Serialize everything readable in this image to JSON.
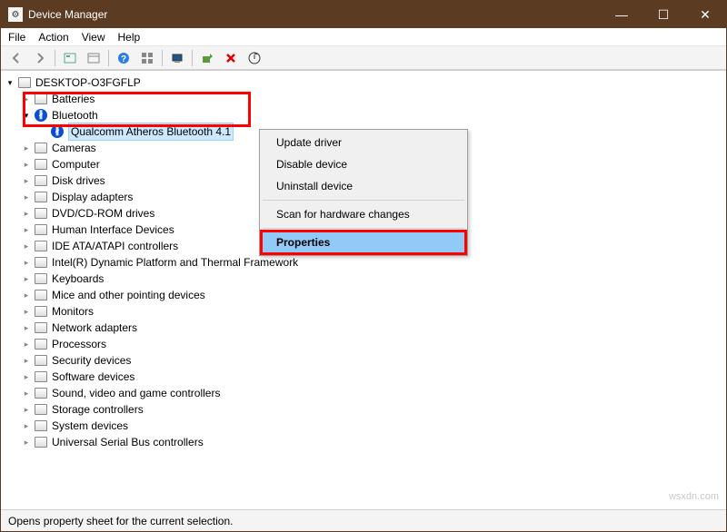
{
  "window": {
    "title": "Device Manager",
    "min_tooltip": "Minimize",
    "max_tooltip": "Maximize",
    "close_tooltip": "Close"
  },
  "menu": {
    "file": "File",
    "action": "Action",
    "view": "View",
    "help": "Help"
  },
  "toolbar_icons": [
    "back-icon",
    "forward-icon",
    "sep",
    "show-folder-icon",
    "properties-icon",
    "sep",
    "help-icon",
    "tile-icon",
    "sep",
    "monitor-icon",
    "sep",
    "scan-hw-icon",
    "remove-icon",
    "update-icon"
  ],
  "tree": {
    "root": "DESKTOP-O3FGFLP",
    "items": [
      {
        "label": "Batteries",
        "icon": "battery"
      },
      {
        "label": "Bluetooth",
        "icon": "bluetooth",
        "expanded": true,
        "children": [
          {
            "label": "Qualcomm Atheros Bluetooth 4.1",
            "icon": "bluetooth",
            "selected": true
          }
        ]
      },
      {
        "label": "Cameras",
        "icon": "camera"
      },
      {
        "label": "Computer",
        "icon": "computer"
      },
      {
        "label": "Disk drives",
        "icon": "disk"
      },
      {
        "label": "Display adapters",
        "icon": "display"
      },
      {
        "label": "DVD/CD-ROM drives",
        "icon": "dvd"
      },
      {
        "label": "Human Interface Devices",
        "icon": "hid"
      },
      {
        "label": "IDE ATA/ATAPI controllers",
        "icon": "ide"
      },
      {
        "label": "Intel(R) Dynamic Platform and Thermal Framework",
        "icon": "intel"
      },
      {
        "label": "Keyboards",
        "icon": "keyboard"
      },
      {
        "label": "Mice and other pointing devices",
        "icon": "mouse"
      },
      {
        "label": "Monitors",
        "icon": "monitor"
      },
      {
        "label": "Network adapters",
        "icon": "network"
      },
      {
        "label": "Processors",
        "icon": "cpu"
      },
      {
        "label": "Security devices",
        "icon": "security"
      },
      {
        "label": "Software devices",
        "icon": "software"
      },
      {
        "label": "Sound, video and game controllers",
        "icon": "sound"
      },
      {
        "label": "Storage controllers",
        "icon": "storage"
      },
      {
        "label": "System devices",
        "icon": "system"
      },
      {
        "label": "Universal Serial Bus controllers",
        "icon": "usb"
      }
    ]
  },
  "context_menu": {
    "update": "Update driver",
    "disable": "Disable device",
    "uninstall": "Uninstall device",
    "scan": "Scan for hardware changes",
    "properties": "Properties"
  },
  "status_text": "Opens property sheet for the current selection.",
  "watermark": "wsxdn.com"
}
